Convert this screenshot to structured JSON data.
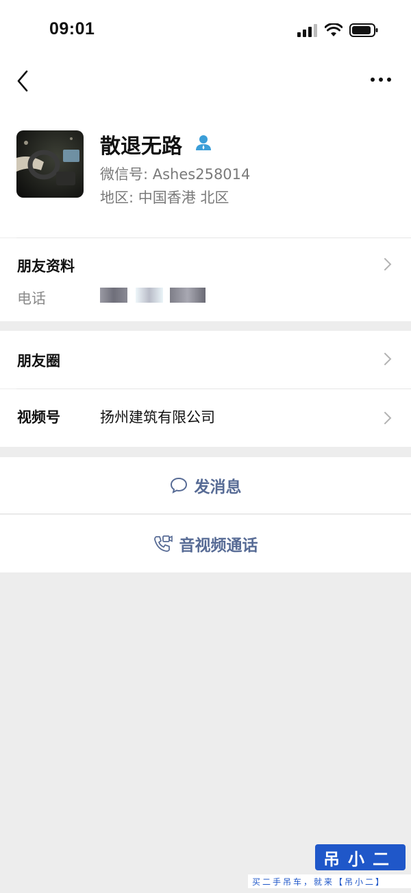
{
  "status_bar": {
    "time": "09:01",
    "icons": [
      "signal-icon",
      "wifi-icon",
      "battery-icon"
    ]
  },
  "nav": {
    "back_icon": "chevron-left-icon",
    "more_icon": "more-dots-icon"
  },
  "profile": {
    "name": "散退无路",
    "wechat_id": "微信号: Ashes258014",
    "region": "地区: 中国香港 北区",
    "badge_icon": "person-icon"
  },
  "friend_info": {
    "title": "朋友资料",
    "phone_label": "电话"
  },
  "moments": {
    "title": "朋友圈"
  },
  "channels": {
    "title": "视频号",
    "value": "扬州建筑有限公司"
  },
  "actions": {
    "message_label": "发消息",
    "call_label": "音视频通话"
  },
  "watermark": {
    "brand": "吊小二",
    "slogan": "买二手吊车，就来【吊小二】"
  },
  "colors": {
    "link": "#576b95",
    "background": "#ededed",
    "watermark": "#1f57c9"
  }
}
